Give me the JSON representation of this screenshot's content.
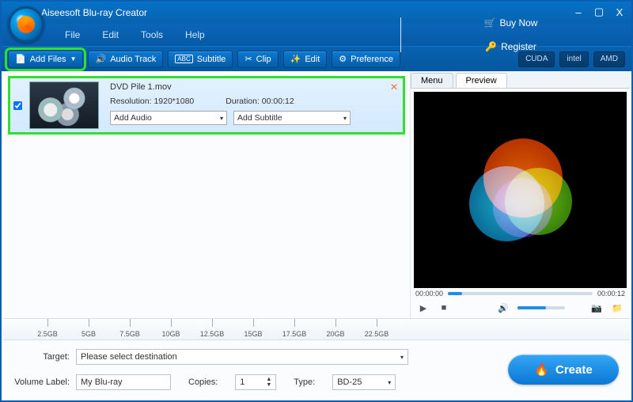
{
  "app": {
    "title": "Aiseesoft Blu-ray Creator"
  },
  "window_controls": {
    "min": "–",
    "max": "▢",
    "close": "X"
  },
  "menu": {
    "file": "File",
    "edit": "Edit",
    "tools": "Tools",
    "help": "Help",
    "buy": "Buy Now",
    "register": "Register"
  },
  "toolbar": {
    "add_files": "Add Files",
    "audio_track": "Audio Track",
    "subtitle": "Subtitle",
    "clip": "Clip",
    "edit": "Edit",
    "preference": "Preference",
    "gpu": [
      "CUDA",
      "intel",
      "AMD"
    ]
  },
  "file_item": {
    "name": "DVD Pile 1.mov",
    "res_label": "Resolution:",
    "res_value": "1920*1080",
    "dur_label": "Duration:",
    "dur_value": "00:00:12",
    "add_audio": "Add Audio",
    "add_subtitle": "Add Subtitle"
  },
  "preview": {
    "tab_menu": "Menu",
    "tab_preview": "Preview",
    "time_start": "00:00:00",
    "time_end": "00:00:12"
  },
  "size_ticks": [
    "2.5GB",
    "5GB",
    "7.5GB",
    "10GB",
    "12.5GB",
    "15GB",
    "17.5GB",
    "20GB",
    "22.5GB"
  ],
  "bottom": {
    "target_label": "Target:",
    "target_value": "Please select destination",
    "volume_label": "Volume Label:",
    "volume_value": "My Blu-ray",
    "copies_label": "Copies:",
    "copies_value": "1",
    "type_label": "Type:",
    "type_value": "BD-25",
    "create": "Create"
  }
}
